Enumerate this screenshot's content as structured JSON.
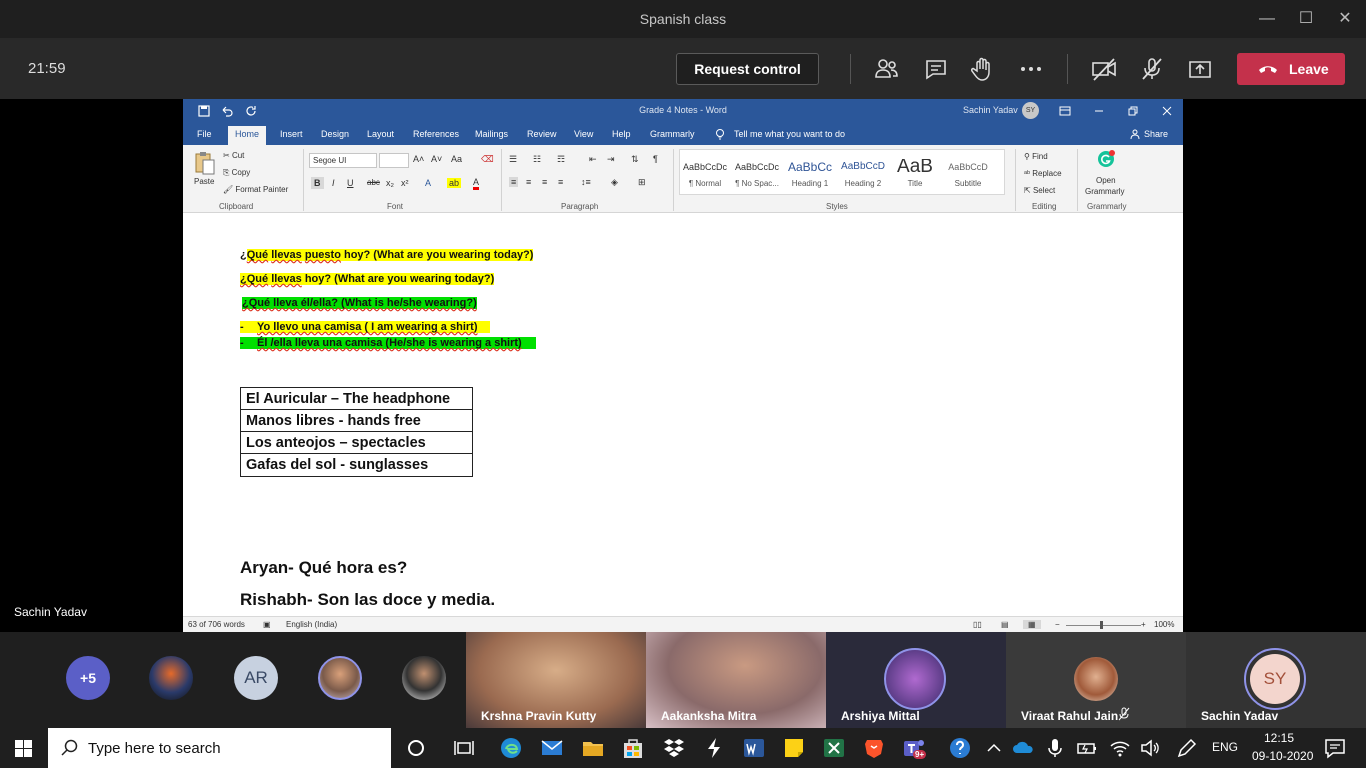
{
  "window": {
    "title": "Spanish class",
    "minimize": "—",
    "maximize": "☐",
    "close": "✕"
  },
  "meeting": {
    "time": "21:59",
    "request_control": "Request control",
    "leave": "Leave",
    "presenter": "Sachin Yadav",
    "more_participants": "+5",
    "participants": [
      {
        "initials": "AR"
      },
      {
        "name": "Krshna Pravin Kutty"
      },
      {
        "name": "Aakanksha Mitra"
      },
      {
        "name": "Arshiya Mittal"
      },
      {
        "name": "Viraat Rahul Jain"
      },
      {
        "name": "Sachin Yadav",
        "initials": "SY"
      }
    ]
  },
  "word": {
    "doc_title": "Grade 4 Notes - Word",
    "user_name": "Sachin Yadav",
    "user_initials": "SY",
    "tabs": [
      "File",
      "Home",
      "Insert",
      "Design",
      "Layout",
      "References",
      "Mailings",
      "Review",
      "View",
      "Help",
      "Grammarly"
    ],
    "tell_me": "Tell me what you want to do",
    "share": "Share",
    "ribbon": {
      "paste": "Paste",
      "cut": "Cut",
      "copy": "Copy",
      "format_painter": "Format Painter",
      "font_name": "Segoe UI",
      "find": "Find",
      "replace": "Replace",
      "select": "Select",
      "open_grammarly_1": "Open",
      "open_grammarly_2": "Grammarly",
      "groups": [
        "Clipboard",
        "Font",
        "Paragraph",
        "Styles",
        "Editing",
        "Grammarly"
      ],
      "styles": [
        {
          "preview": "AaBbCcDc",
          "name": "¶ Normal"
        },
        {
          "preview": "AaBbCcDc",
          "name": "¶ No Spac..."
        },
        {
          "preview": "AaBbCc",
          "name": "Heading 1"
        },
        {
          "preview": "AaBbCcD",
          "name": "Heading 2"
        },
        {
          "preview": "AaB",
          "name": "Title"
        },
        {
          "preview": "AaBbCcD",
          "name": "Subtitle"
        }
      ]
    },
    "document": {
      "q1_pre": "¿",
      "q1_a": "Qué",
      "q1_b": "llevas",
      "q1_c": "puesto",
      "q1_rest": " hoy? (What are you wearing today?)",
      "q2_a": "¿Qué",
      "q2_b": "llevas",
      "q2_rest": " hoy? (What are you wearing today?)",
      "q3": "¿Qué lleva él/ella? (What is he/she wearing?)",
      "a1_bullet": "-",
      "a1": "Yo llevo una camisa ( I am wearing a shirt)",
      "a2_bullet": "-",
      "a2": "Él /ella lleva una camisa (He/she is wearing a shirt)",
      "vocab": [
        "El Auricular – The headphone",
        "Manos libres  - hands free",
        "Los anteojos – spectacles",
        "Gafas del sol - sunglasses"
      ],
      "line1": "Aryan- Qué hora es?",
      "line2": "Rishabh- Son las doce y media."
    },
    "status": {
      "words": "63 of 706 words",
      "language": "English (India)",
      "zoom": "100%"
    }
  },
  "taskbar": {
    "search_placeholder": "Type here to search",
    "lang": "ENG",
    "time": "12:15",
    "date": "09-10-2020",
    "teams_badge": "9+"
  }
}
